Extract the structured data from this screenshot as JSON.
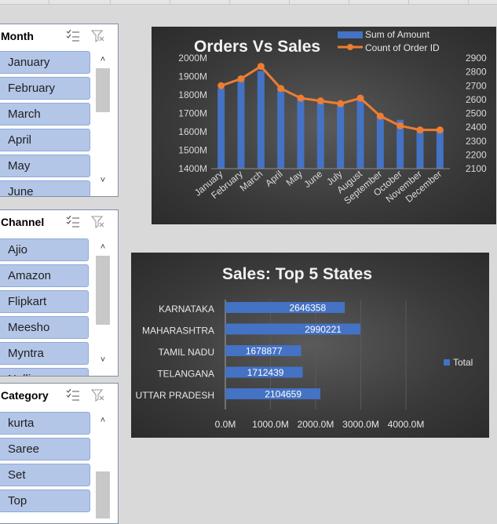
{
  "slicers": {
    "month": {
      "title": "Month",
      "items": [
        "January",
        "February",
        "March",
        "April",
        "May",
        "June"
      ]
    },
    "channel": {
      "title": "Channel",
      "items": [
        "Ajio",
        "Amazon",
        "Flipkart",
        "Meesho",
        "Myntra",
        "Nalli"
      ]
    },
    "category": {
      "title": "Category",
      "items": [
        "kurta",
        "Saree",
        "Set",
        "Top"
      ]
    }
  },
  "charts": {
    "orders_sales": {
      "title": "Orders Vs Sales",
      "legend": [
        "Sum of Amount",
        "Count of Order ID"
      ]
    },
    "top_states": {
      "title": "Sales: Top 5 States",
      "legend": [
        "Total"
      ]
    }
  },
  "chart_data": [
    {
      "type": "bar",
      "title": "Orders Vs Sales",
      "categories": [
        "January",
        "February",
        "March",
        "April",
        "May",
        "June",
        "July",
        "August",
        "September",
        "October",
        "November",
        "December"
      ],
      "series": [
        {
          "name": "Sum of Amount",
          "type": "bar",
          "axis": "left",
          "values": [
            1835,
            1885,
            1930,
            1830,
            1790,
            1765,
            1750,
            1790,
            1690,
            1665,
            1620,
            1615
          ],
          "color": "#4472c4"
        },
        {
          "name": "Count of Order ID",
          "type": "line",
          "axis": "right",
          "values": [
            2700,
            2750,
            2840,
            2680,
            2610,
            2590,
            2570,
            2610,
            2480,
            2410,
            2380,
            2380
          ],
          "color": "#ed7d31"
        }
      ],
      "y_left": {
        "min": 1400,
        "max": 2000,
        "ticks": [
          "1400M",
          "1500M",
          "1600M",
          "1700M",
          "1800M",
          "1900M",
          "2000M"
        ]
      },
      "y_right": {
        "min": 2100,
        "max": 2900,
        "ticks": [
          "2100",
          "2200",
          "2300",
          "2400",
          "2500",
          "2600",
          "2700",
          "2800",
          "2900"
        ]
      },
      "legend_position": "top-right"
    },
    {
      "type": "bar",
      "orientation": "horizontal",
      "title": "Sales: Top 5 States",
      "categories": [
        "KARNATAKA",
        "MAHARASHTRA",
        "TAMIL NADU",
        "TELANGANA",
        "UTTAR PRADESH"
      ],
      "series": [
        {
          "name": "Total",
          "values": [
            2646358,
            2990221,
            1678877,
            1712439,
            2104659
          ],
          "labels": [
            "2646358",
            "2990221",
            "1678877",
            "1712439",
            "2104659"
          ],
          "color": "#4472c4"
        }
      ],
      "x_axis": {
        "min": 0,
        "max": 4000000,
        "ticks": [
          "0.0M",
          "1000.0M",
          "2000.0M",
          "3000.0M",
          "4000.0M"
        ]
      },
      "legend_position": "right"
    }
  ]
}
